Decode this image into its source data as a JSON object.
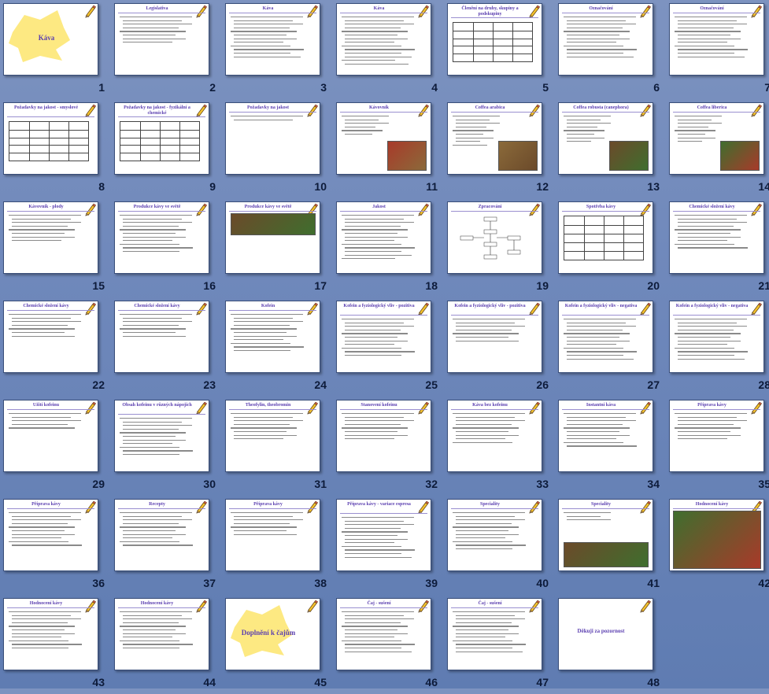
{
  "slides": [
    {
      "n": "1",
      "title": "Káva",
      "kind": "title"
    },
    {
      "n": "2",
      "title": "Legislativa",
      "lines": 8,
      "kind": "text"
    },
    {
      "n": "3",
      "title": "Káva",
      "lines": 12,
      "kind": "text"
    },
    {
      "n": "4",
      "title": "Káva",
      "lines": 14,
      "kind": "text"
    },
    {
      "n": "5",
      "title": "Členění na druhy, skupiny a podskupiny",
      "kind": "table"
    },
    {
      "n": "6",
      "title": "Označování",
      "lines": 12,
      "kind": "text"
    },
    {
      "n": "7",
      "title": "Označování",
      "lines": 12,
      "kind": "text"
    },
    {
      "n": "8",
      "title": "Požadavky na jakost - smyslové",
      "kind": "table"
    },
    {
      "n": "9",
      "title": "Požadavky na jakost - fyzikální a chemické",
      "kind": "table"
    },
    {
      "n": "10",
      "title": "Požadavky na jakost",
      "lines": 2,
      "kind": "text"
    },
    {
      "n": "11",
      "title": "Kávovník",
      "lines": 6,
      "kind": "image"
    },
    {
      "n": "12",
      "title": "Coffea arabica",
      "lines": 9,
      "kind": "image"
    },
    {
      "n": "13",
      "title": "Coffea robusta (canephora)",
      "lines": 8,
      "kind": "image"
    },
    {
      "n": "14",
      "title": "Coffea liberica",
      "lines": 8,
      "kind": "image"
    },
    {
      "n": "15",
      "title": "Kávovník - plody",
      "lines": 8,
      "kind": "text"
    },
    {
      "n": "16",
      "title": "Produkce kávy ve světě",
      "lines": 11,
      "kind": "text"
    },
    {
      "n": "17",
      "title": "Produkce kávy ve světě",
      "lines": 5,
      "kind": "image"
    },
    {
      "n": "18",
      "title": "Jakost",
      "lines": 13,
      "kind": "text"
    },
    {
      "n": "19",
      "title": "Zpracování",
      "kind": "diagram"
    },
    {
      "n": "20",
      "title": "Spotřeba kávy",
      "kind": "table"
    },
    {
      "n": "21",
      "title": "Chemické složení kávy",
      "lines": 10,
      "kind": "text"
    },
    {
      "n": "22",
      "title": "Chemické složení kávy",
      "lines": 7,
      "kind": "text"
    },
    {
      "n": "23",
      "title": "Chemické složení kávy",
      "lines": 7,
      "kind": "text"
    },
    {
      "n": "24",
      "title": "Kofein",
      "lines": 11,
      "kind": "text"
    },
    {
      "n": "25",
      "title": "Kofein a fyziologický vliv - pozitiva",
      "lines": 11,
      "kind": "text"
    },
    {
      "n": "26",
      "title": "Kofein a fyziologický vliv - pozitiva",
      "lines": 7,
      "kind": "text"
    },
    {
      "n": "27",
      "title": "Kofein a fyziologický vliv - negativa",
      "lines": 12,
      "kind": "text"
    },
    {
      "n": "28",
      "title": "Kofein a fyziologický vliv - negativa",
      "lines": 12,
      "kind": "text"
    },
    {
      "n": "29",
      "title": "Užití kofeinu",
      "lines": 5,
      "kind": "text"
    },
    {
      "n": "30",
      "title": "Obsah kofeinu v různých nápojích",
      "lines": 11,
      "kind": "text"
    },
    {
      "n": "31",
      "title": "Theofylin, theobromin",
      "lines": 8,
      "kind": "text"
    },
    {
      "n": "32",
      "title": "Stanovení kofeinu",
      "lines": 8,
      "kind": "text"
    },
    {
      "n": "33",
      "title": "Káva bez kofeinu",
      "lines": 9,
      "kind": "text"
    },
    {
      "n": "34",
      "title": "Instantní káva",
      "lines": 10,
      "kind": "text"
    },
    {
      "n": "35",
      "title": "Příprava kávy",
      "lines": 8,
      "kind": "text"
    },
    {
      "n": "36",
      "title": "Příprava kávy",
      "lines": 10,
      "kind": "text"
    },
    {
      "n": "37",
      "title": "Recepty",
      "lines": 10,
      "kind": "text"
    },
    {
      "n": "38",
      "title": "Příprava kávy",
      "lines": 7,
      "kind": "text"
    },
    {
      "n": "39",
      "title": "Příprava kávy - variace espresa",
      "lines": 12,
      "kind": "text"
    },
    {
      "n": "40",
      "title": "Speciality",
      "lines": 11,
      "kind": "text"
    },
    {
      "n": "41",
      "title": "Speciality",
      "lines": 3,
      "kind": "image"
    },
    {
      "n": "42",
      "title": "Hodnocení kávy",
      "lines": 0,
      "kind": "image"
    },
    {
      "n": "43",
      "title": "Hodnocení kávy",
      "lines": 11,
      "kind": "text"
    },
    {
      "n": "44",
      "title": "Hodnocení kávy",
      "lines": 11,
      "kind": "text"
    },
    {
      "n": "45",
      "title": "Doplnění k čajům",
      "kind": "title"
    },
    {
      "n": "46",
      "title": "Čaj - sušení",
      "lines": 12,
      "kind": "text"
    },
    {
      "n": "47",
      "title": "Čaj - sušení",
      "lines": 12,
      "kind": "text"
    },
    {
      "n": "48",
      "title": "Děkuji za pozornost",
      "kind": "end"
    }
  ],
  "colors": {
    "background": "#6f88bb",
    "title": "#5b3fb0",
    "slide_number": "#0d1b3a",
    "splash": "#fde982"
  },
  "icons": {
    "pencil": "pencil-icon",
    "splash": "yellow-splash"
  }
}
